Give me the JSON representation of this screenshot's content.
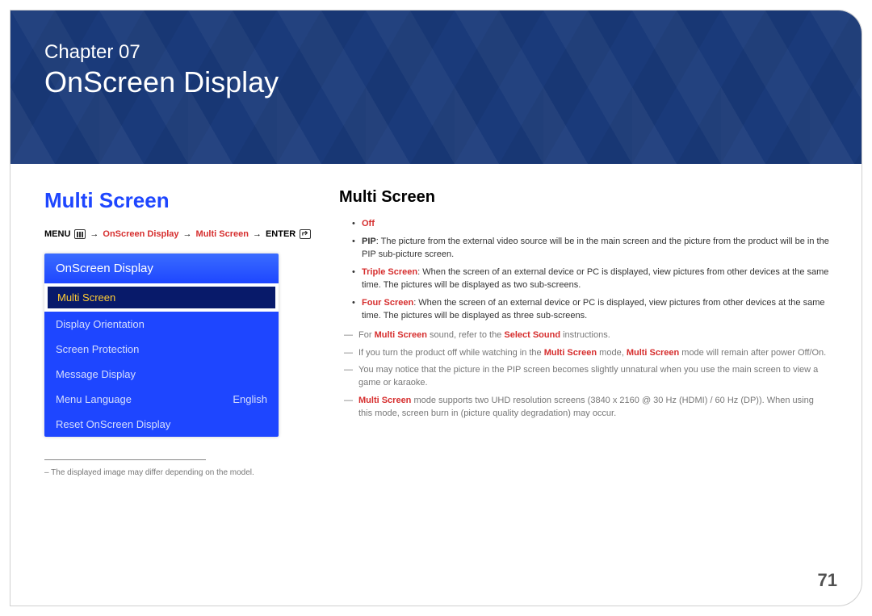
{
  "banner": {
    "chapter_label": "Chapter  07",
    "chapter_title": "OnScreen Display"
  },
  "left": {
    "section_title": "Multi Screen",
    "breadcrumb": {
      "menu": "MENU",
      "arrow": "→",
      "bc1": "OnScreen Display",
      "bc2": "Multi Screen",
      "enter": "ENTER"
    },
    "osd": {
      "header": "OnScreen Display",
      "items": [
        {
          "label": "Multi Screen",
          "value": "",
          "selected": true
        },
        {
          "label": "Display Orientation",
          "value": "",
          "selected": false
        },
        {
          "label": "Screen Protection",
          "value": "",
          "selected": false
        },
        {
          "label": "Message Display",
          "value": "",
          "selected": false
        },
        {
          "label": "Menu Language",
          "value": "English",
          "selected": false
        },
        {
          "label": "Reset OnScreen Display",
          "value": "",
          "selected": false
        }
      ]
    },
    "footnote": "–  The displayed image may differ depending on the model."
  },
  "right": {
    "section_title": "Multi Screen",
    "bullets": [
      {
        "label": "Off",
        "label_red": true,
        "text": ""
      },
      {
        "label": "PIP",
        "label_red": false,
        "text": ": The picture from the external video source will be in the main screen and the picture from the product will be in the PIP sub-picture screen."
      },
      {
        "label": "Triple Screen",
        "label_red": true,
        "text": ": When the screen of an external device or PC is displayed, view pictures from other devices at the same time. The pictures will be displayed as two sub-screens."
      },
      {
        "label": "Four Screen",
        "label_red": true,
        "text": ": When the screen of an external device or PC is displayed, view pictures from other devices at the same time. The pictures will be displayed as three sub-screens."
      }
    ],
    "notes": [
      {
        "pre": "For ",
        "red1": "Multi Screen",
        "mid": " sound, refer to the ",
        "red2": "Select Sound",
        "post": " instructions."
      },
      {
        "pre": "If you turn the product off while watching in the ",
        "red1": "Multi Screen",
        "mid": " mode, ",
        "red2": "Multi Screen",
        "post": " mode will remain after power Off/On."
      },
      {
        "pre": "You may notice that the picture in the PIP screen becomes slightly unnatural when you use the main screen to view a game or karaoke.",
        "red1": "",
        "mid": "",
        "red2": "",
        "post": ""
      },
      {
        "pre": "",
        "red1": "Multi Screen",
        "mid": " mode supports two UHD resolution screens (3840 x 2160 @ 30 Hz (HDMI) / 60 Hz (DP)). When using this mode, screen burn in (picture quality degradation) may occur.",
        "red2": "",
        "post": ""
      }
    ]
  },
  "page_number": "71"
}
